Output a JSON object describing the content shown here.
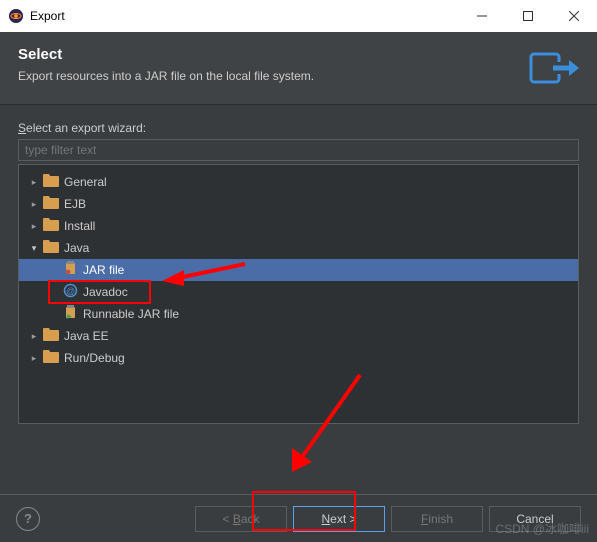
{
  "window": {
    "title": "Export"
  },
  "header": {
    "title": "Select",
    "description": "Export resources into a JAR file on the local file system."
  },
  "content": {
    "wizard_label_prefix": "S",
    "wizard_label_rest": "elect an export wizard:",
    "filter_placeholder": "type filter text"
  },
  "tree": [
    {
      "label": "General",
      "level": 0,
      "expanded": false,
      "type": "folder"
    },
    {
      "label": "EJB",
      "level": 0,
      "expanded": false,
      "type": "folder"
    },
    {
      "label": "Install",
      "level": 0,
      "expanded": false,
      "type": "folder"
    },
    {
      "label": "Java",
      "level": 0,
      "expanded": true,
      "type": "folder"
    },
    {
      "label": "JAR file",
      "level": 1,
      "expanded": null,
      "type": "jar",
      "selected": true
    },
    {
      "label": "Javadoc",
      "level": 1,
      "expanded": null,
      "type": "javadoc"
    },
    {
      "label": "Runnable JAR file",
      "level": 1,
      "expanded": null,
      "type": "runjar"
    },
    {
      "label": "Java EE",
      "level": 0,
      "expanded": false,
      "type": "folder"
    },
    {
      "label": "Run/Debug",
      "level": 0,
      "expanded": false,
      "type": "folder"
    }
  ],
  "footer": {
    "back": "< Back",
    "back_ul": "B",
    "next_ul": "N",
    "next_rest": "ext >",
    "finish_ul": "F",
    "finish_rest": "inish",
    "cancel": "Cancel"
  },
  "watermark": "CSDN @冰咖啡iii"
}
